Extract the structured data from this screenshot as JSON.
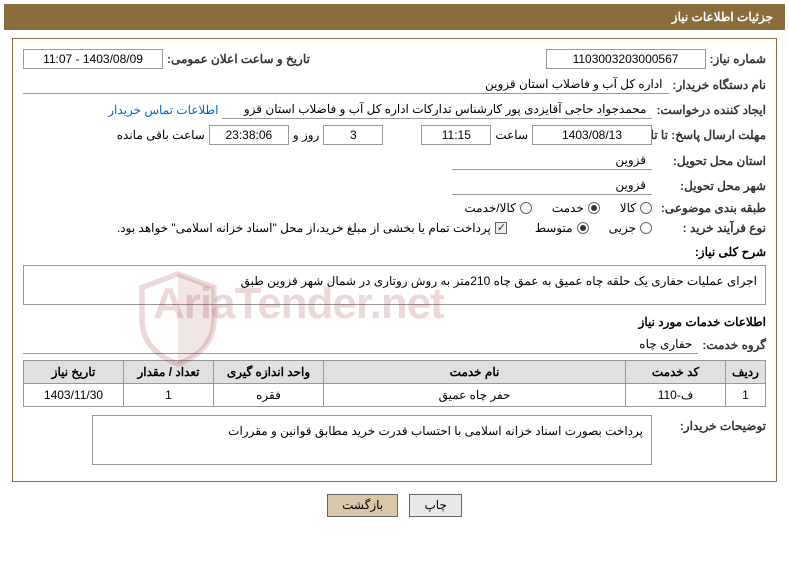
{
  "header_title": "جزئیات اطلاعات نیاز",
  "labels": {
    "need_number": "شماره نیاز:",
    "announce_datetime": "تاریخ و ساعت اعلان عمومی:",
    "buyer_org": "نام دستگاه خریدار:",
    "requester": "ایجاد کننده درخواست:",
    "buyer_contact": "اطلاعات تماس خریدار",
    "deadline": "مهلت ارسال پاسخ: تا تاریخ:",
    "time_word": "ساعت",
    "days_and": "روز و",
    "time_remaining": "ساعت باقی مانده",
    "delivery_province": "استان محل تحویل:",
    "delivery_city": "شهر محل تحویل:",
    "subject_class": "طبقه بندی موضوعی:",
    "purchase_type": "نوع فرآیند خرید :",
    "goods": "کالا",
    "service": "خدمت",
    "goods_service": "کالا/خدمت",
    "minor": "جزیی",
    "medium": "متوسط",
    "payment_note": "پرداخت تمام یا بخشی از مبلغ خرید،از محل \"اسناد خزانه اسلامی\" خواهد بود.",
    "overall_desc": "شرح کلی نیاز:",
    "services_info": "اطلاعات خدمات مورد نیاز",
    "service_group": "گروه خدمت:",
    "buyer_notes": "توضیحات خریدار:",
    "print_btn": "چاپ",
    "back_btn": "بازگشت"
  },
  "values": {
    "need_number": "1103003203000567",
    "announce_datetime": "1403/08/09 - 11:07",
    "buyer_org": "اداره کل آب و فاضلاب استان قزوین",
    "requester": "محمدجواد حاجی آقایزدی پور کارشناس تدارکات اداره کل آب و فاضلاب استان قزو",
    "deadline_date": "1403/08/13",
    "deadline_time": "11:15",
    "remaining_days": "3",
    "remaining_time": "23:38:06",
    "delivery_province": "قزوین",
    "delivery_city": "قزوین",
    "overall_desc": "اجرای عملیات حفاری  یک   حلقه چاه عمیق به عمق چاه 210متر  به روش روتاری در شمال شهر  قزوین  طبق",
    "service_group": "حفاری چاه",
    "buyer_notes": "پرداخت بصورت اسناد خزانه اسلامی با احتساب قدرت خرید مطابق قوانین و مقررات"
  },
  "table": {
    "headers": {
      "row": "ردیف",
      "service_code": "کد خدمت",
      "service_name": "نام خدمت",
      "unit": "واحد اندازه گیری",
      "qty": "تعداد / مقدار",
      "need_date": "تاریخ نیاز"
    },
    "rows": [
      {
        "row": "1",
        "code": "ف-110",
        "name": "حفر چاه عمیق",
        "unit": "فقره",
        "qty": "1",
        "date": "1403/11/30"
      }
    ]
  },
  "watermark": "AriaTender.net"
}
